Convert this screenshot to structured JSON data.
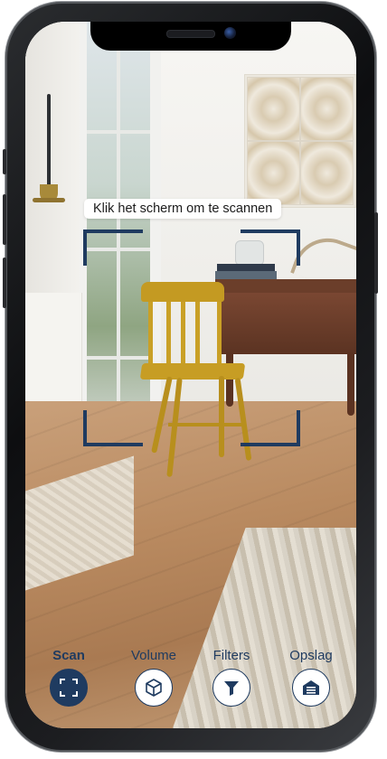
{
  "scan_hint": "Klik het scherm om te scannen",
  "nav": {
    "items": [
      {
        "label": "Scan",
        "icon": "scan-frame-icon",
        "active": true
      },
      {
        "label": "Volume",
        "icon": "cube-icon",
        "active": false
      },
      {
        "label": "Filters",
        "icon": "filter-icon",
        "active": false
      },
      {
        "label": "Opslag",
        "icon": "storage-icon",
        "active": false
      }
    ]
  },
  "colors": {
    "accent": "#1f3b60",
    "background_button": "#ffffff"
  }
}
